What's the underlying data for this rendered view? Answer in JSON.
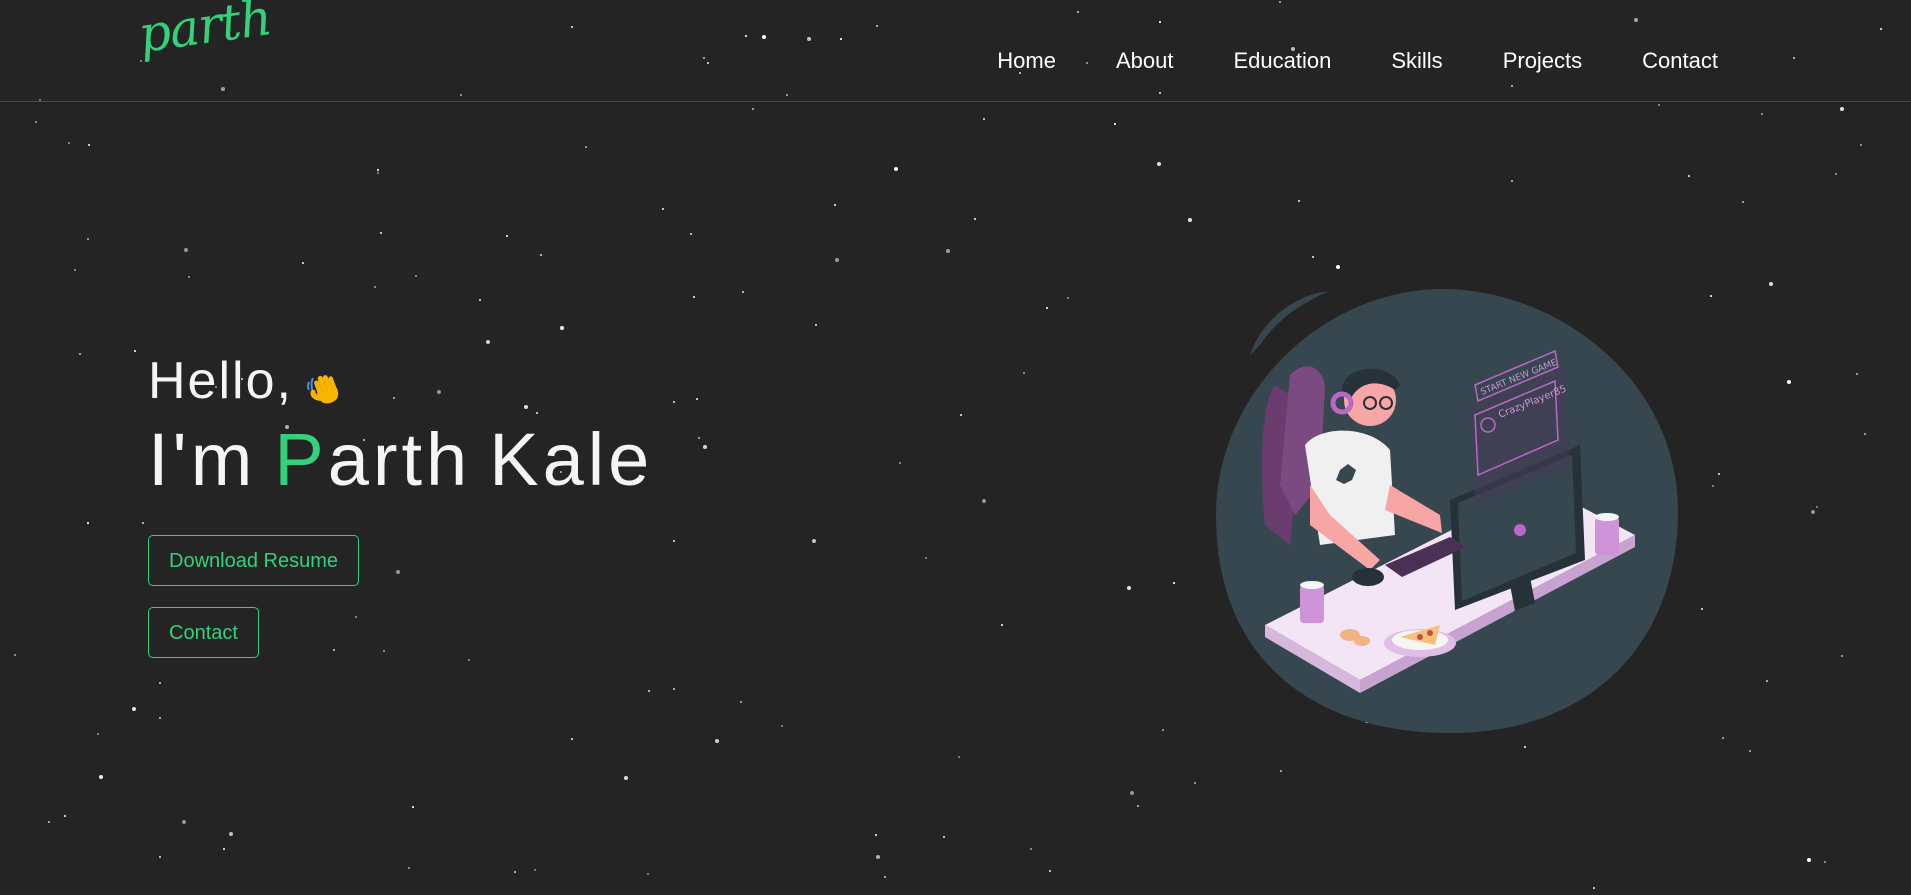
{
  "logo": {
    "text": "parth"
  },
  "nav": {
    "items": [
      {
        "label": "Home"
      },
      {
        "label": "About"
      },
      {
        "label": "Education"
      },
      {
        "label": "Skills"
      },
      {
        "label": "Projects"
      },
      {
        "label": "Contact"
      }
    ]
  },
  "hero": {
    "greeting": "Hello,",
    "greeting_icon": "waving-hand-icon",
    "intro_prefix": "I'm",
    "name_first_initial": "P",
    "name_first_rest": "arth",
    "name_last": "Kale",
    "accent_color": "#33d17a",
    "download_resume_label": "Download Resume",
    "contact_label": "Contact"
  },
  "illustration": {
    "screen_title": "START NEW GAME",
    "player_name": "CrazyPlayer85"
  },
  "colors": {
    "background": "#242424",
    "accent": "#33d17a",
    "text": "#f5f5f5"
  }
}
